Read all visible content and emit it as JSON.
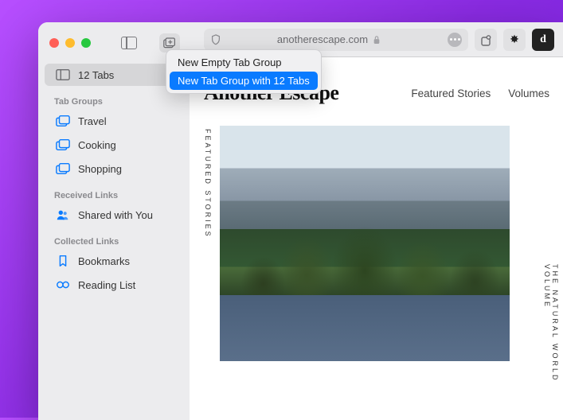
{
  "address": {
    "domain": "anotherescape.com"
  },
  "sidebar": {
    "tabs_label": "12 Tabs",
    "section_groups": "Tab Groups",
    "groups": [
      {
        "label": "Travel"
      },
      {
        "label": "Cooking"
      },
      {
        "label": "Shopping"
      }
    ],
    "section_received": "Received Links",
    "shared_label": "Shared with You",
    "section_collected": "Collected Links",
    "bookmarks_label": "Bookmarks",
    "readinglist_label": "Reading List"
  },
  "popup": {
    "item_new_empty": "New Empty Tab Group",
    "item_new_with": "New Tab Group with 12 Tabs"
  },
  "page": {
    "logo": "Another Escape",
    "nav": [
      {
        "label": "Featured Stories"
      },
      {
        "label": "Volumes"
      }
    ],
    "vertical_left": "FEATURED STORIES",
    "vertical_right": "THE NATURAL WORLD VOLUME"
  },
  "extensions": {
    "sun": "✸",
    "d": "d"
  }
}
